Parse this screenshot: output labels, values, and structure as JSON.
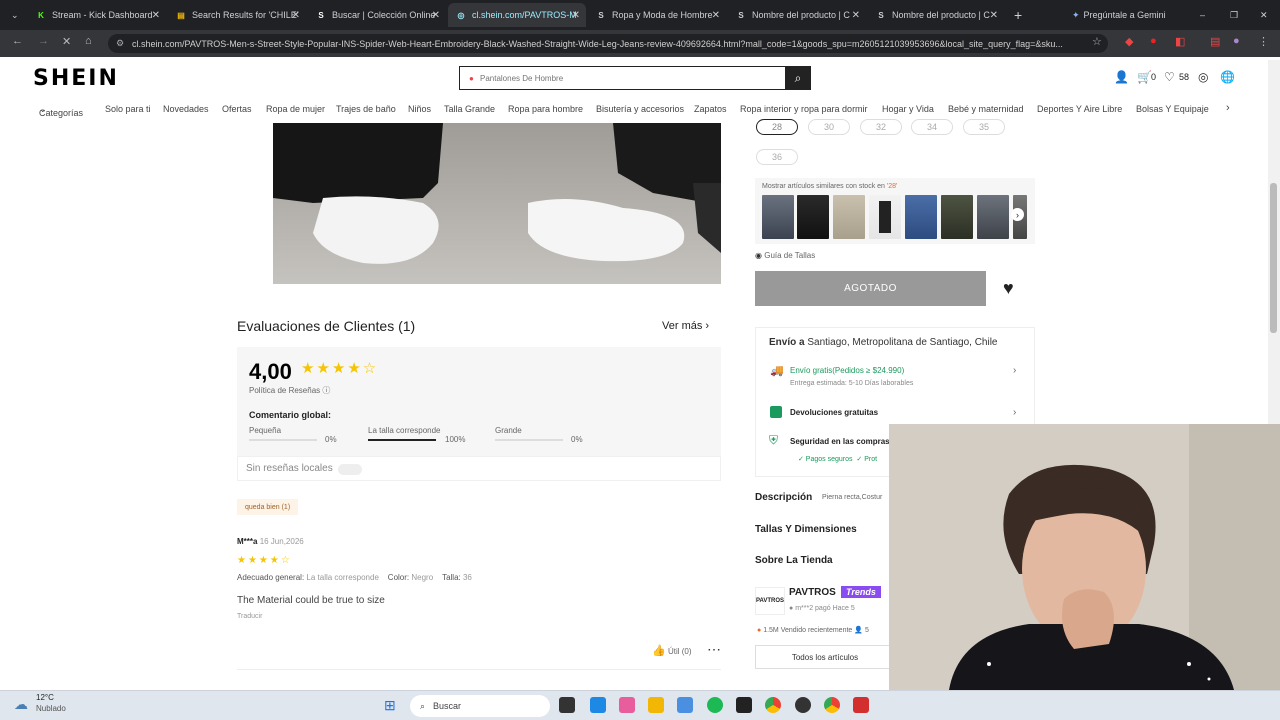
{
  "browser": {
    "tabs": [
      {
        "label": "Stream - Kick Dashboard",
        "fav": "K",
        "color": "#53fc18"
      },
      {
        "label": "Search Results for 'CHILE'",
        "fav": "▤",
        "color": "#f2b705"
      },
      {
        "label": "Buscar | Colección Online",
        "fav": "S",
        "color": "#ffffff"
      },
      {
        "label": "cl.shein.com/PAVTROS-M",
        "fav": "◎",
        "color": "#9ef"
      },
      {
        "label": "Ropa y Moda de Hombre",
        "fav": "S",
        "color": "#ffffff"
      },
      {
        "label": "Nombre del producto | C",
        "fav": "S",
        "color": "#ffffff"
      },
      {
        "label": "Nombre del producto | C",
        "fav": "S",
        "color": "#ffffff"
      }
    ],
    "gemini": "Pregúntale a Gemini",
    "url": "cl.shein.com/PAVTROS-Men-s-Street-Style-Popular-INS-Spider-Web-Heart-Embroidery-Black-Washed-Straight-Wide-Leg-Jeans-review-409692664.html?mall_code=1&goods_spu=m2605121039953696&local_site_query_flag=&sku..."
  },
  "header": {
    "logo": "SHEIN",
    "search_placeholder": "Pantalones De Hombre",
    "cart_count": "0",
    "wish_count": "58"
  },
  "categories": [
    "Categorías",
    "Solo para ti",
    "Novedades",
    "Ofertas",
    "Ropa de mujer",
    "Trajes de baño",
    "Niños",
    "Talla Grande",
    "Ropa para hombre",
    "Bisutería y accesorios",
    "Zapatos",
    "Ropa interior y ropa para dormir",
    "Hogar y Vida",
    "Bebé y maternidad",
    "Deportes Y Aire Libre",
    "Bolsas Y Equipaje"
  ],
  "reviews": {
    "title": "Evaluaciones de Clientes (1)",
    "ver_mas": "Ver más",
    "rating": "4,00",
    "rating_stars": 4,
    "policy": "Política de Reseñas",
    "overall_label": "Comentario global:",
    "fit": [
      {
        "label": "Pequeña",
        "pct": "0%",
        "value": 0
      },
      {
        "label": "La talla corresponde",
        "pct": "100%",
        "value": 1
      },
      {
        "label": "Grande",
        "pct": "0%",
        "value": 0
      }
    ],
    "local_toggle": "Sin reseñas locales",
    "tag": "queda bien (1)",
    "review": {
      "user": "M***a",
      "date": "16 Jun,2026",
      "stars": 4,
      "fit_label": "Adecuado general:",
      "fit_value": "La talla corresponde",
      "color_label": "Color:",
      "color_value": "Negro",
      "size_label": "Talla:",
      "size_value": "36",
      "text": "The Material could be true to size",
      "translate": "Traducir",
      "useful": "Útil (0)"
    }
  },
  "product": {
    "sizes": [
      "28",
      "30",
      "32",
      "34",
      "35",
      "36"
    ],
    "similar_text": "Mostrar artículos similares con stock en",
    "similar_size": "'28'",
    "size_guide": "Guía de Tallas",
    "soldout": "AGOTADO",
    "ship_to_label": "Envío a",
    "ship_to": "Santiago, Metropolitana de Santiago, Chile",
    "free_ship": "Envío gratis(Pedidos ≥ $24.990)",
    "delivery": "Entrega estimada: 5-10 Días laborables",
    "returns": "Devoluciones gratuitas",
    "security": "Seguridad en las compras",
    "secure_pay": "✓ Pagos seguros",
    "secure_pay2": "✓ Prot",
    "description": "Descripción",
    "description_text": "Pierna recta,Costur",
    "sizes_dims": "Tallas Y Dimensiones",
    "about_store": "Sobre La Tienda",
    "store_name": "PAVTROS",
    "store_badge": "Trends",
    "store_logo": "PAVTROS",
    "store_pay": "m***2 pagó",
    "store_pay_time": "Hace 5",
    "sold_recent": "1.5M Vendido recientemente",
    "sold_extra": "5",
    "all_items": "Todos los artículos"
  },
  "taskbar": {
    "weather_temp": "12°C",
    "weather_text": "Nublado",
    "search": "Buscar"
  }
}
